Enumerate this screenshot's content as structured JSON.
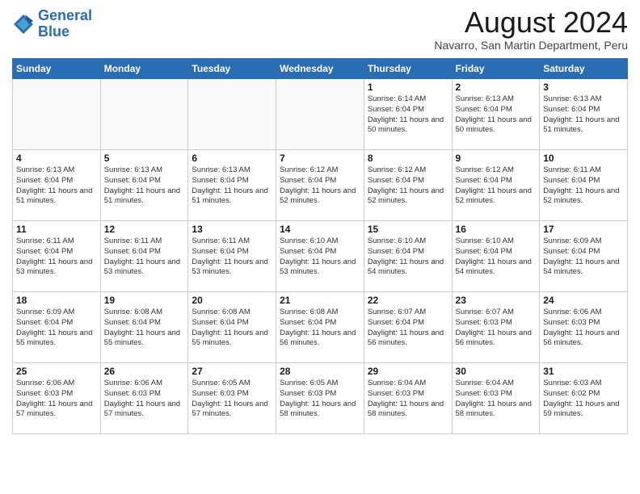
{
  "header": {
    "logo_line1": "General",
    "logo_line2": "Blue",
    "month_title": "August 2024",
    "location": "Navarro, San Martin Department, Peru"
  },
  "days_of_week": [
    "Sunday",
    "Monday",
    "Tuesday",
    "Wednesday",
    "Thursday",
    "Friday",
    "Saturday"
  ],
  "weeks": [
    [
      {
        "day": "",
        "empty": true
      },
      {
        "day": "",
        "empty": true
      },
      {
        "day": "",
        "empty": true
      },
      {
        "day": "",
        "empty": true
      },
      {
        "day": "1",
        "sunrise": "6:14 AM",
        "sunset": "6:04 PM",
        "daylight": "11 hours and 50 minutes."
      },
      {
        "day": "2",
        "sunrise": "6:13 AM",
        "sunset": "6:04 PM",
        "daylight": "11 hours and 50 minutes."
      },
      {
        "day": "3",
        "sunrise": "6:13 AM",
        "sunset": "6:04 PM",
        "daylight": "11 hours and 51 minutes."
      }
    ],
    [
      {
        "day": "4",
        "sunrise": "6:13 AM",
        "sunset": "6:04 PM",
        "daylight": "11 hours and 51 minutes."
      },
      {
        "day": "5",
        "sunrise": "6:13 AM",
        "sunset": "6:04 PM",
        "daylight": "11 hours and 51 minutes."
      },
      {
        "day": "6",
        "sunrise": "6:13 AM",
        "sunset": "6:04 PM",
        "daylight": "11 hours and 51 minutes."
      },
      {
        "day": "7",
        "sunrise": "6:12 AM",
        "sunset": "6:04 PM",
        "daylight": "11 hours and 52 minutes."
      },
      {
        "day": "8",
        "sunrise": "6:12 AM",
        "sunset": "6:04 PM",
        "daylight": "11 hours and 52 minutes."
      },
      {
        "day": "9",
        "sunrise": "6:12 AM",
        "sunset": "6:04 PM",
        "daylight": "11 hours and 52 minutes."
      },
      {
        "day": "10",
        "sunrise": "6:11 AM",
        "sunset": "6:04 PM",
        "daylight": "11 hours and 52 minutes."
      }
    ],
    [
      {
        "day": "11",
        "sunrise": "6:11 AM",
        "sunset": "6:04 PM",
        "daylight": "11 hours and 53 minutes."
      },
      {
        "day": "12",
        "sunrise": "6:11 AM",
        "sunset": "6:04 PM",
        "daylight": "11 hours and 53 minutes."
      },
      {
        "day": "13",
        "sunrise": "6:11 AM",
        "sunset": "6:04 PM",
        "daylight": "11 hours and 53 minutes."
      },
      {
        "day": "14",
        "sunrise": "6:10 AM",
        "sunset": "6:04 PM",
        "daylight": "11 hours and 53 minutes."
      },
      {
        "day": "15",
        "sunrise": "6:10 AM",
        "sunset": "6:04 PM",
        "daylight": "11 hours and 54 minutes."
      },
      {
        "day": "16",
        "sunrise": "6:10 AM",
        "sunset": "6:04 PM",
        "daylight": "11 hours and 54 minutes."
      },
      {
        "day": "17",
        "sunrise": "6:09 AM",
        "sunset": "6:04 PM",
        "daylight": "11 hours and 54 minutes."
      }
    ],
    [
      {
        "day": "18",
        "sunrise": "6:09 AM",
        "sunset": "6:04 PM",
        "daylight": "11 hours and 55 minutes."
      },
      {
        "day": "19",
        "sunrise": "6:08 AM",
        "sunset": "6:04 PM",
        "daylight": "11 hours and 55 minutes."
      },
      {
        "day": "20",
        "sunrise": "6:08 AM",
        "sunset": "6:04 PM",
        "daylight": "11 hours and 55 minutes."
      },
      {
        "day": "21",
        "sunrise": "6:08 AM",
        "sunset": "6:04 PM",
        "daylight": "11 hours and 56 minutes."
      },
      {
        "day": "22",
        "sunrise": "6:07 AM",
        "sunset": "6:04 PM",
        "daylight": "11 hours and 56 minutes."
      },
      {
        "day": "23",
        "sunrise": "6:07 AM",
        "sunset": "6:03 PM",
        "daylight": "11 hours and 56 minutes."
      },
      {
        "day": "24",
        "sunrise": "6:06 AM",
        "sunset": "6:03 PM",
        "daylight": "11 hours and 56 minutes."
      }
    ],
    [
      {
        "day": "25",
        "sunrise": "6:06 AM",
        "sunset": "6:03 PM",
        "daylight": "11 hours and 57 minutes."
      },
      {
        "day": "26",
        "sunrise": "6:06 AM",
        "sunset": "6:03 PM",
        "daylight": "11 hours and 57 minutes."
      },
      {
        "day": "27",
        "sunrise": "6:05 AM",
        "sunset": "6:03 PM",
        "daylight": "11 hours and 57 minutes."
      },
      {
        "day": "28",
        "sunrise": "6:05 AM",
        "sunset": "6:03 PM",
        "daylight": "11 hours and 58 minutes."
      },
      {
        "day": "29",
        "sunrise": "6:04 AM",
        "sunset": "6:03 PM",
        "daylight": "11 hours and 58 minutes."
      },
      {
        "day": "30",
        "sunrise": "6:04 AM",
        "sunset": "6:03 PM",
        "daylight": "11 hours and 58 minutes."
      },
      {
        "day": "31",
        "sunrise": "6:03 AM",
        "sunset": "6:02 PM",
        "daylight": "11 hours and 59 minutes."
      }
    ]
  ]
}
